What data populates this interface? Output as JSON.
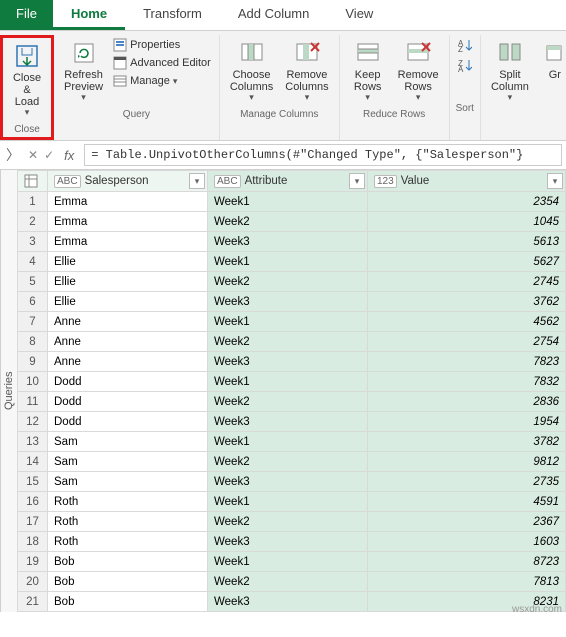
{
  "tabs": {
    "file": "File",
    "home": "Home",
    "transform": "Transform",
    "add_column": "Add Column",
    "view": "View"
  },
  "ribbon": {
    "close": {
      "close_load": "Close &\nLoad",
      "group": "Close"
    },
    "query": {
      "refresh": "Refresh\nPreview",
      "properties": "Properties",
      "adv_editor": "Advanced Editor",
      "manage": "Manage",
      "group": "Query"
    },
    "cols": {
      "choose": "Choose\nColumns",
      "remove": "Remove\nColumns",
      "group": "Manage Columns"
    },
    "rows": {
      "keep": "Keep\nRows",
      "remove": "Remove\nRows",
      "group": "Reduce Rows"
    },
    "sort": {
      "group": "Sort"
    },
    "split": {
      "split": "Split\nColumn",
      "group_by": "Gr"
    }
  },
  "formula": {
    "fx": "fx",
    "text": "= Table.UnpivotOtherColumns(#\"Changed Type\", {\"Salesperson\"}"
  },
  "side": {
    "queries": "Queries"
  },
  "grid": {
    "headers": {
      "col1": "Salesperson",
      "col2": "Attribute",
      "col3": "Value",
      "type_text": "ABC",
      "type_num": "123"
    },
    "rows": [
      {
        "n": 1,
        "s": "Emma",
        "a": "Week1",
        "v": 2354
      },
      {
        "n": 2,
        "s": "Emma",
        "a": "Week2",
        "v": 1045
      },
      {
        "n": 3,
        "s": "Emma",
        "a": "Week3",
        "v": 5613
      },
      {
        "n": 4,
        "s": "Ellie",
        "a": "Week1",
        "v": 5627
      },
      {
        "n": 5,
        "s": "Ellie",
        "a": "Week2",
        "v": 2745
      },
      {
        "n": 6,
        "s": "Ellie",
        "a": "Week3",
        "v": 3762
      },
      {
        "n": 7,
        "s": "Anne",
        "a": "Week1",
        "v": 4562
      },
      {
        "n": 8,
        "s": "Anne",
        "a": "Week2",
        "v": 2754
      },
      {
        "n": 9,
        "s": "Anne",
        "a": "Week3",
        "v": 7823
      },
      {
        "n": 10,
        "s": "Dodd",
        "a": "Week1",
        "v": 7832
      },
      {
        "n": 11,
        "s": "Dodd",
        "a": "Week2",
        "v": 2836
      },
      {
        "n": 12,
        "s": "Dodd",
        "a": "Week3",
        "v": 1954
      },
      {
        "n": 13,
        "s": "Sam",
        "a": "Week1",
        "v": 3782
      },
      {
        "n": 14,
        "s": "Sam",
        "a": "Week2",
        "v": 9812
      },
      {
        "n": 15,
        "s": "Sam",
        "a": "Week3",
        "v": 2735
      },
      {
        "n": 16,
        "s": "Roth",
        "a": "Week1",
        "v": 4591
      },
      {
        "n": 17,
        "s": "Roth",
        "a": "Week2",
        "v": 2367
      },
      {
        "n": 18,
        "s": "Roth",
        "a": "Week3",
        "v": 1603
      },
      {
        "n": 19,
        "s": "Bob",
        "a": "Week1",
        "v": 8723
      },
      {
        "n": 20,
        "s": "Bob",
        "a": "Week2",
        "v": 7813
      },
      {
        "n": 21,
        "s": "Bob",
        "a": "Week3",
        "v": 8231
      }
    ]
  },
  "watermark": "wsxdn.com"
}
